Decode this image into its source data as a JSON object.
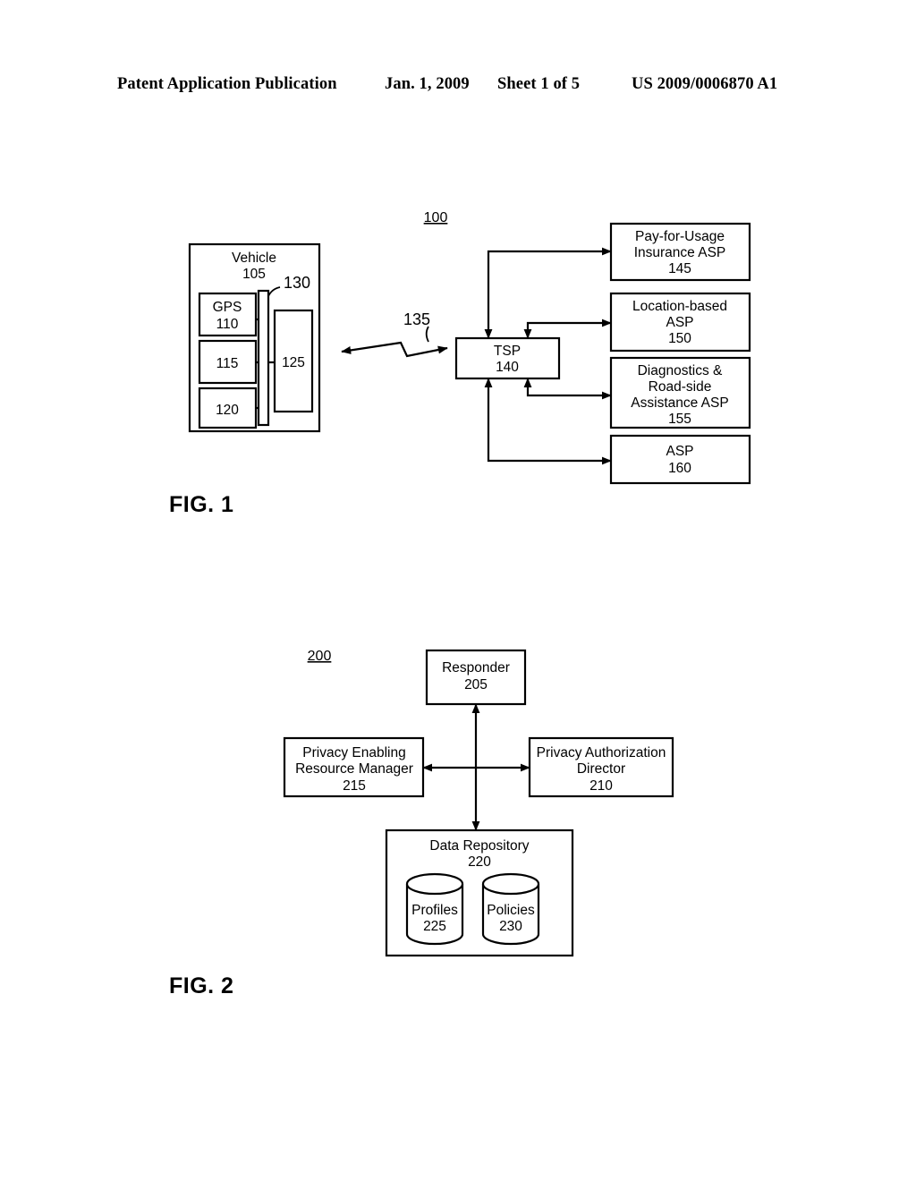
{
  "header": {
    "publication": "Patent Application Publication",
    "date": "Jan. 1, 2009",
    "sheet": "Sheet 1 of 5",
    "patent_number": "US 2009/0006870 A1"
  },
  "figures": [
    {
      "caption": "FIG. 1",
      "system_ref": "100",
      "vehicle": {
        "title": "Vehicle",
        "ref": "105",
        "bus_ref": "130",
        "components": [
          {
            "label": "GPS",
            "ref": "110"
          },
          {
            "label": "",
            "ref": "115"
          },
          {
            "label": "",
            "ref": "120"
          },
          {
            "label": "",
            "ref": "125"
          }
        ]
      },
      "wireless_link_ref": "135",
      "tsp": {
        "label": "TSP",
        "ref": "140"
      },
      "asps": [
        {
          "lines": [
            "Pay-for-Usage",
            "Insurance ASP"
          ],
          "ref": "145"
        },
        {
          "lines": [
            "Location-based",
            "ASP"
          ],
          "ref": "150"
        },
        {
          "lines": [
            "Diagnostics &",
            "Road-side",
            "Assistance ASP"
          ],
          "ref": "155"
        },
        {
          "lines": [
            "ASP"
          ],
          "ref": "160"
        }
      ]
    },
    {
      "caption": "FIG. 2",
      "system_ref": "200",
      "responder": {
        "label": "Responder",
        "ref": "205"
      },
      "privacy_authorization_director": {
        "lines": [
          "Privacy Authorization",
          "Director"
        ],
        "ref": "210"
      },
      "privacy_enabling_resource_manager": {
        "lines": [
          "Privacy Enabling",
          "Resource Manager"
        ],
        "ref": "215"
      },
      "data_repository": {
        "label": "Data Repository",
        "ref": "220",
        "stores": [
          {
            "label": "Profiles",
            "ref": "225"
          },
          {
            "label": "Policies",
            "ref": "230"
          }
        ]
      }
    }
  ]
}
